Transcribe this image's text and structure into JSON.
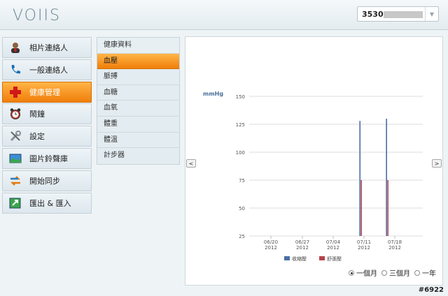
{
  "header": {
    "logo": "VOIIS",
    "device_select": "3530"
  },
  "nav": {
    "items": [
      {
        "label": "相片連絡人",
        "icon": "contact-photo-icon"
      },
      {
        "label": "一般連絡人",
        "icon": "phone-icon"
      },
      {
        "label": "健康管理",
        "icon": "health-cross-icon",
        "active": true
      },
      {
        "label": "鬧鐘",
        "icon": "alarm-clock-icon"
      },
      {
        "label": "設定",
        "icon": "settings-tools-icon"
      },
      {
        "label": "圖片鈴聲庫",
        "icon": "media-library-icon"
      },
      {
        "label": "開始同步",
        "icon": "sync-icon"
      },
      {
        "label": "匯出 & 匯入",
        "icon": "import-export-icon"
      }
    ]
  },
  "submenu": {
    "title": "健康資料",
    "items": [
      "血壓",
      "脈搏",
      "血糖",
      "血氧",
      "體重",
      "體溫",
      "計步器"
    ],
    "active": "血壓"
  },
  "pager": {
    "prev": "<",
    "next": ">"
  },
  "chart_data": {
    "type": "bar",
    "ylabel": "mmHg",
    "ylim": [
      25,
      150
    ],
    "yticks": [
      25,
      50,
      75,
      100,
      125,
      150
    ],
    "xticks": [
      {
        "date": "06/20",
        "year": "2012"
      },
      {
        "date": "06/27",
        "year": "2012"
      },
      {
        "date": "07/04",
        "year": "2012"
      },
      {
        "date": "07/11",
        "year": "2012"
      },
      {
        "date": "07/18",
        "year": "2012"
      }
    ],
    "series": [
      {
        "name": "收縮壓",
        "color": "#4a6fa5",
        "points": [
          {
            "x": "07/10",
            "value": 128
          },
          {
            "x": "07/16",
            "value": 130
          }
        ]
      },
      {
        "name": "舒張壓",
        "color": "#b5424a",
        "points": [
          {
            "x": "07/10",
            "value": 75
          },
          {
            "x": "07/16",
            "value": 75
          }
        ]
      }
    ],
    "grid": true,
    "legend": "bottom"
  },
  "range": {
    "options": [
      "一個月",
      "三個月",
      "一年"
    ],
    "selected": "一個月"
  },
  "watermark": "#6922"
}
